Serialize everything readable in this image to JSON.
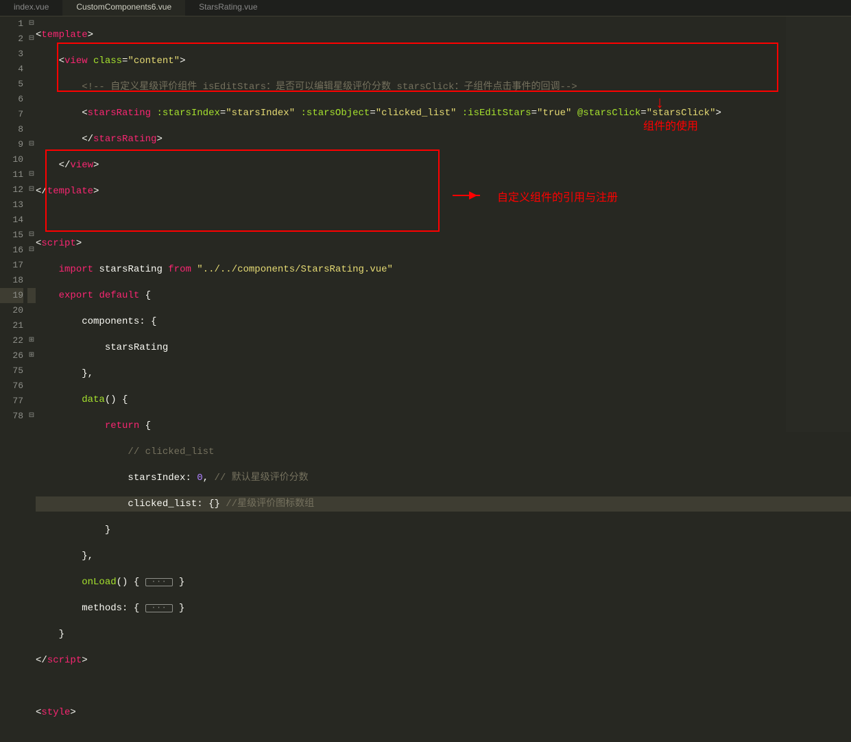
{
  "tabs": {
    "items": [
      {
        "label": "index.vue",
        "active": false
      },
      {
        "label": "CustomComponents6.vue",
        "active": true
      },
      {
        "label": "StarsRating.vue",
        "active": false
      }
    ]
  },
  "gutter_lines": [
    "1",
    "2",
    "3",
    "4",
    "5",
    "6",
    "7",
    "8",
    "9",
    "10",
    "11",
    "12",
    "13",
    "14",
    "15",
    "16",
    "17",
    "18",
    "19",
    "20",
    "21",
    "22",
    "26",
    "75",
    "76",
    "77",
    "78"
  ],
  "fold_marks": [
    "⊟",
    "⊟",
    "",
    "",
    "",
    "",
    "",
    "",
    "⊟",
    "",
    "⊟",
    "⊟",
    "",
    "",
    "⊟",
    "⊟",
    "",
    "",
    "",
    "",
    "",
    "⊞",
    "⊞",
    "",
    "",
    "",
    "⊟"
  ],
  "annotations": {
    "usage": "组件的使用",
    "register": "自定义组件的引用与注册"
  },
  "code": {
    "l1": {
      "t1": "<",
      "t2": "template",
      "t3": ">"
    },
    "l2": {
      "t1": "<",
      "t2": "view",
      "sp": " ",
      "a1": "class",
      "eq": "=",
      "s1": "\"content\"",
      "t3": ">"
    },
    "l3": {
      "cm": "<!-- 自定义星级评价组件 isEditStars：是否可以编辑星级评价分数 starsClick：子组件点击事件的回调-->"
    },
    "l4": {
      "t1": "<",
      "t2": "starsRating",
      "sp": " ",
      "a1": ":starsIndex",
      "eq": "=",
      "s1": "\"starsIndex\"",
      "sp2": " ",
      "a2": ":starsObject",
      "s2": "\"clicked_list\"",
      "sp3": " ",
      "a3": ":isEditStars",
      "s3": "\"true\"",
      "sp4": " ",
      "a4": "@starsClick",
      "s4": "\"starsClick\"",
      "t3": ">"
    },
    "l5": {
      "t1": "</",
      "t2": "starsRating",
      "t3": ">"
    },
    "l6": {
      "t1": "</",
      "t2": "view",
      "t3": ">"
    },
    "l7": {
      "t1": "</",
      "t2": "template",
      "t3": ">"
    },
    "l9": {
      "t1": "<",
      "t2": "script",
      "t3": ">"
    },
    "l10": {
      "k1": "import",
      "sp": " ",
      "id": "starsRating",
      "sp2": " ",
      "k2": "from",
      "sp3": " ",
      "s1": "\"../../components/StarsRating.vue\""
    },
    "l11": {
      "k1": "export",
      "sp": " ",
      "k2": "default",
      "sp2": " ",
      "b": "{"
    },
    "l12": {
      "id": "components",
      "c": ":",
      "sp": " ",
      "b": "{"
    },
    "l13": {
      "id": "starsRating"
    },
    "l14": {
      "b": "},"
    },
    "l15": {
      "fn": "data",
      "p": "()",
      "sp": " ",
      "b": "{"
    },
    "l16": {
      "k": "return",
      "sp": " ",
      "b": "{"
    },
    "l17": {
      "cm": "// clicked_list"
    },
    "l18": {
      "id": "starsIndex",
      "c": ":",
      "sp": " ",
      "n": "0",
      "cm2": ", ",
      "cm": "// 默认星级评价分数"
    },
    "l19": {
      "id": "clicked_list",
      "c": ":",
      "sp": " ",
      "b": "{}",
      "sp2": " ",
      "cm": "//星级评价图标数组"
    },
    "l20": {
      "b": "}"
    },
    "l21": {
      "b": "},"
    },
    "l22": {
      "fn": "onLoad",
      "p": "()",
      "sp": " ",
      "b": "{",
      "sp2": " ",
      "fold": "···",
      "sp3": " ",
      "b2": "}"
    },
    "l26": {
      "id": "methods",
      "c": ":",
      "sp": " ",
      "b": "{",
      "sp2": " ",
      "fold": "···",
      "sp3": " ",
      "b2": "}"
    },
    "l75": {
      "b": "}"
    },
    "l76": {
      "t1": "</",
      "t2": "script",
      "t3": ">"
    },
    "l78": {
      "t1": "<",
      "t2": "style",
      "t3": ">"
    }
  }
}
